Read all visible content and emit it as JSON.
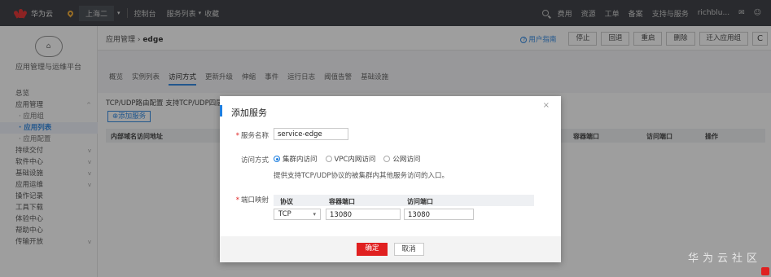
{
  "topbar": {
    "brand": "华为云",
    "region": "上海二",
    "nav": [
      "控制台",
      "服务列表",
      "收藏"
    ],
    "right": [
      "费用",
      "资源",
      "工单",
      "备案",
      "支持与服务",
      "richblu...",
      "✉",
      "☺"
    ]
  },
  "sidebar": {
    "logo_text": "⌂",
    "title": "应用管理与运维平台",
    "items": [
      {
        "label": "总览",
        "chev": ""
      },
      {
        "label": "应用管理",
        "chev": "^"
      },
      {
        "label": "· 应用组",
        "chev": ""
      },
      {
        "label": "· 应用列表",
        "chev": ""
      },
      {
        "label": "· 应用配置",
        "chev": ""
      },
      {
        "label": "持续交付",
        "chev": "v"
      },
      {
        "label": "软件中心",
        "chev": "v"
      },
      {
        "label": "基础设施",
        "chev": "v"
      },
      {
        "label": "应用运维",
        "chev": "v"
      },
      {
        "label": "操作记录",
        "chev": ""
      },
      {
        "label": "工具下载",
        "chev": ""
      },
      {
        "label": "体验中心",
        "chev": ""
      },
      {
        "label": "帮助中心",
        "chev": ""
      },
      {
        "label": "传输开放",
        "chev": "v"
      }
    ]
  },
  "header": {
    "crumb_prefix": "应用管理 › ",
    "crumb_current": "edge",
    "guide": "用户指南",
    "guide_icon": "?",
    "buttons": [
      "停止",
      "回退",
      "重启",
      "删除",
      "迁入应用组"
    ],
    "refresh_icon": "C"
  },
  "tabs": [
    "概览",
    "实例列表",
    "访问方式",
    "更新升级",
    "伸缩",
    "事件",
    "运行日志",
    "阈值告警",
    "基础设施"
  ],
  "content": {
    "section_title": "TCP/UDP路由配置  支持TCP/UDP四层路由转发...",
    "add_service": "⊕添加服务",
    "table_headers": [
      "内部域名访问地址",
      "容器端口",
      "访问端口",
      "操作"
    ]
  },
  "modal": {
    "title": "添加服务",
    "close": "×",
    "service_name_label": "服务名称",
    "service_name_value": "service-edge",
    "access_label": "访问方式",
    "access_options": [
      "集群内访问",
      "VPC内网访问",
      "公网访问"
    ],
    "access_selected": "集群内访问",
    "hint": "提供支持TCP/UDP协议的被集群内其他服务访问的入口。",
    "port_label": "端口映射",
    "port_headers": [
      "协议",
      "容器端口",
      "访问端口"
    ],
    "protocol": "TCP",
    "container_port": "13080",
    "access_port": "13080",
    "ok": "确定",
    "cancel": "取消"
  },
  "watermark": "华为云社区",
  "colors": {
    "accent": "#1e7fe0",
    "danger": "#e02020",
    "topbar": "#2a2d33"
  }
}
